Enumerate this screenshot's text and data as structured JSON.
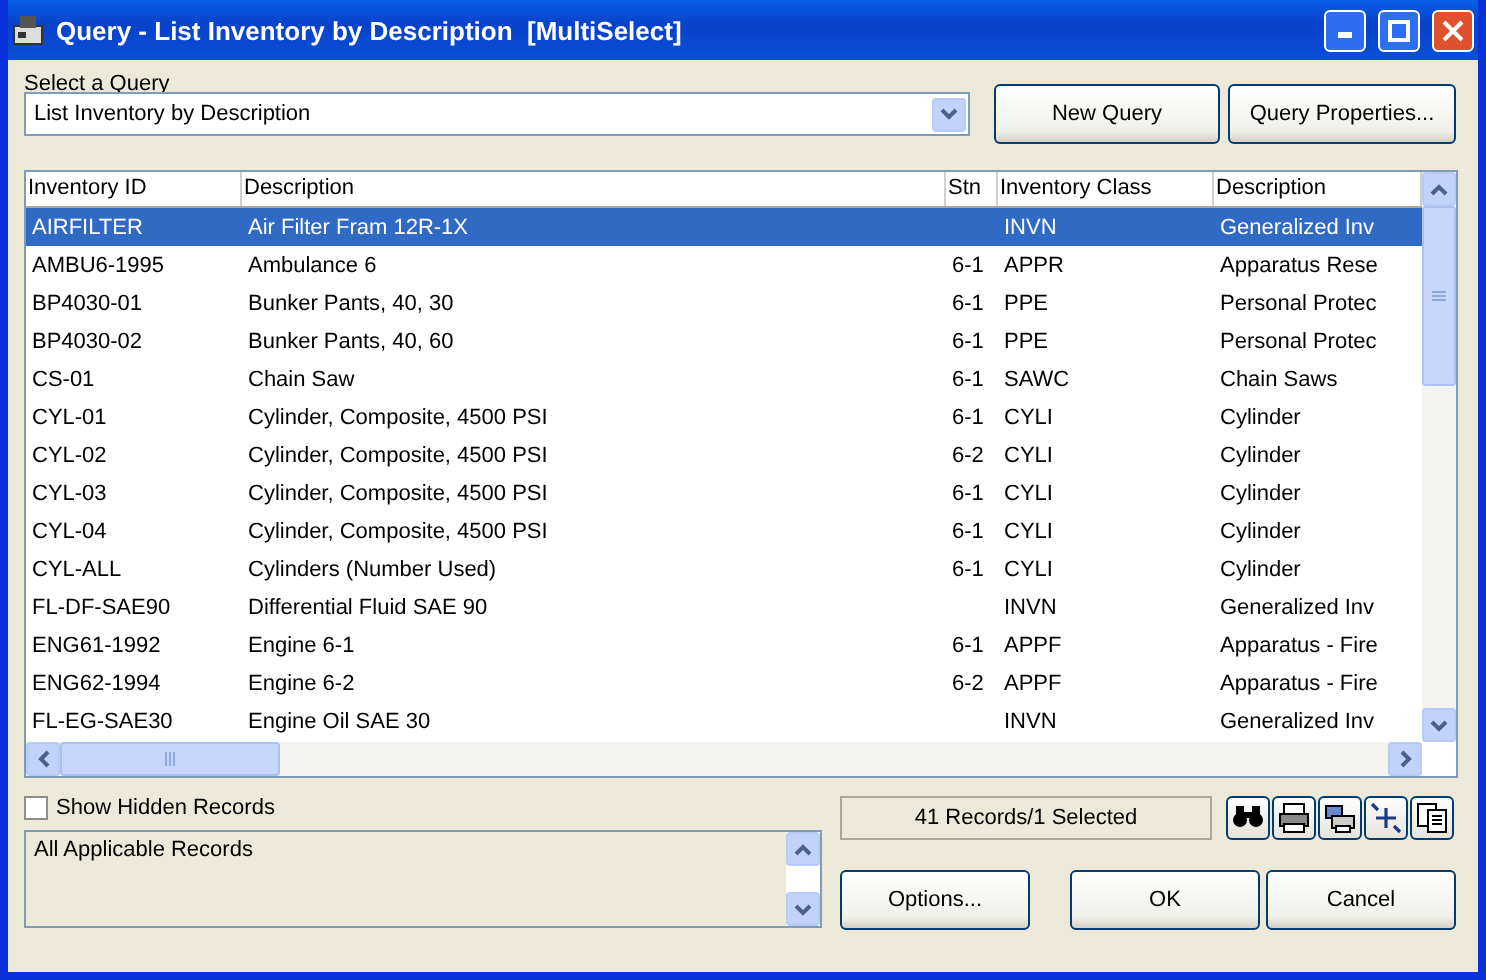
{
  "window": {
    "title": "Query - List Inventory by Description  [MultiSelect]"
  },
  "query_select": {
    "label": "Select a Query",
    "value": "List Inventory by Description"
  },
  "top_buttons": [
    "New Query",
    "Query Properties..."
  ],
  "table": {
    "columns": [
      "Inventory ID",
      "Description",
      "Stn",
      "Inventory Class",
      "Description"
    ],
    "rows": [
      {
        "selected": true,
        "cells": [
          "AIRFILTER",
          "Air Filter Fram 12R-1X",
          "",
          "INVN",
          "Generalized Inv"
        ]
      },
      {
        "selected": false,
        "cells": [
          "AMBU6-1995",
          "Ambulance 6",
          "6-1",
          "APPR",
          "Apparatus Rese"
        ]
      },
      {
        "selected": false,
        "cells": [
          "BP4030-01",
          "Bunker Pants, 40, 30",
          "6-1",
          "PPE",
          "Personal Protec"
        ]
      },
      {
        "selected": false,
        "cells": [
          "BP4030-02",
          "Bunker Pants, 40, 60",
          "6-1",
          "PPE",
          "Personal Protec"
        ]
      },
      {
        "selected": false,
        "cells": [
          "CS-01",
          "Chain Saw",
          "6-1",
          "SAWC",
          "Chain Saws"
        ]
      },
      {
        "selected": false,
        "cells": [
          "CYL-01",
          "Cylinder, Composite, 4500 PSI",
          "6-1",
          "CYLI",
          "Cylinder"
        ]
      },
      {
        "selected": false,
        "cells": [
          "CYL-02",
          "Cylinder, Composite, 4500 PSI",
          "6-2",
          "CYLI",
          "Cylinder"
        ]
      },
      {
        "selected": false,
        "cells": [
          "CYL-03",
          "Cylinder, Composite, 4500 PSI",
          "6-1",
          "CYLI",
          "Cylinder"
        ]
      },
      {
        "selected": false,
        "cells": [
          "CYL-04",
          "Cylinder, Composite, 4500 PSI",
          "6-1",
          "CYLI",
          "Cylinder"
        ]
      },
      {
        "selected": false,
        "cells": [
          "CYL-ALL",
          "Cylinders (Number Used)",
          "6-1",
          "CYLI",
          "Cylinder"
        ]
      },
      {
        "selected": false,
        "cells": [
          "FL-DF-SAE90",
          "Differential Fluid SAE 90",
          "",
          "INVN",
          "Generalized Inv"
        ]
      },
      {
        "selected": false,
        "cells": [
          "ENG61-1992",
          "Engine 6-1",
          "6-1",
          "APPF",
          "Apparatus - Fire"
        ]
      },
      {
        "selected": false,
        "cells": [
          "ENG62-1994",
          "Engine 6-2",
          "6-2",
          "APPF",
          "Apparatus - Fire"
        ]
      },
      {
        "selected": false,
        "cells": [
          "FL-EG-SAE30",
          "Engine Oil SAE 30",
          "",
          "INVN",
          "Generalized Inv"
        ]
      }
    ]
  },
  "show_hidden": {
    "label": "Show Hidden Records",
    "checked": false
  },
  "memo": {
    "text": "All Applicable Records"
  },
  "status": "41 Records/1 Selected",
  "bottom_buttons": [
    "Options...",
    "OK",
    "Cancel"
  ]
}
